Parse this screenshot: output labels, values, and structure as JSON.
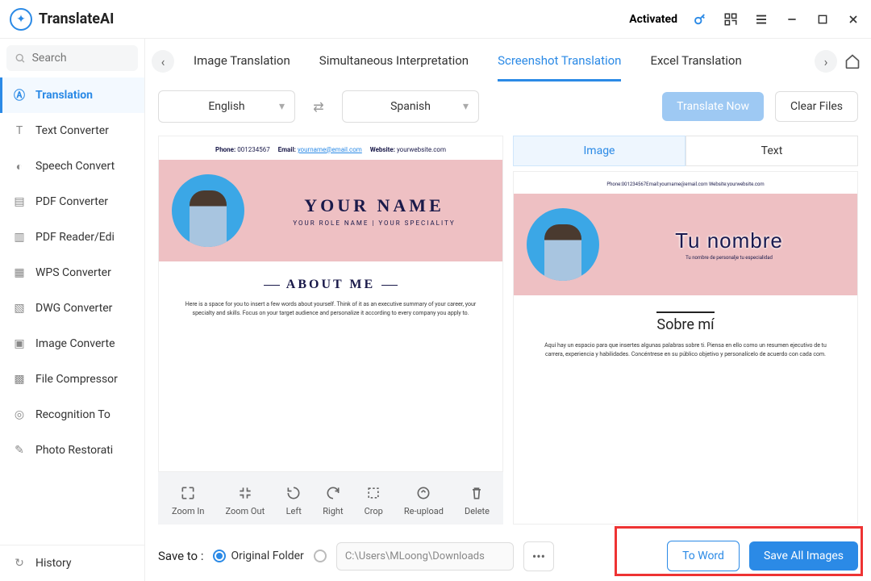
{
  "app": {
    "name": "TranslateAI",
    "activated": "Activated"
  },
  "search": {
    "placeholder": "Search"
  },
  "sidebar": {
    "items": [
      {
        "label": "Translation"
      },
      {
        "label": "Text Converter"
      },
      {
        "label": "Speech Convert"
      },
      {
        "label": "PDF Converter"
      },
      {
        "label": "PDF Reader/Edi"
      },
      {
        "label": "WPS Converter"
      },
      {
        "label": "DWG Converter"
      },
      {
        "label": "Image Converte"
      },
      {
        "label": "File Compressor"
      },
      {
        "label": "Recognition To"
      },
      {
        "label": "Photo Restorati"
      }
    ],
    "history": "History"
  },
  "tabs": {
    "items": [
      {
        "label": "Image Translation"
      },
      {
        "label": "Simultaneous Interpretation"
      },
      {
        "label": "Screenshot Translation"
      },
      {
        "label": "Excel Translation"
      }
    ]
  },
  "lang": {
    "from": "English",
    "to": "Spanish",
    "translate": "Translate Now",
    "clear": "Clear Files"
  },
  "subtabs": {
    "image": "Image",
    "text": "Text"
  },
  "doc": {
    "phone_label": "Phone:",
    "phone": "001234567",
    "email_label": "Email:",
    "email": "yourname@email.com",
    "web_label": "Website:",
    "web": "yourwebsite.com",
    "name": "YOUR NAME",
    "role": "YOUR ROLE NAME | YOUR SPECIALITY",
    "about": "ABOUT ME",
    "about_text": "Here is a space for you to insert a few words about yourself. Think of it as an executive summary of your career, your specialty and skills. Focus on your target audience and personalize it according to every company you apply to."
  },
  "doc_es": {
    "header": "Phone:001234567Email:yourname@email.com Website:yourwebsite.com",
    "name": "Tu nombre",
    "role": "Tu nombre de personalje tu especialidad",
    "about": "Sobre mí",
    "about_text": "Aquí hay un espacio para que insertes algunas palabras sobre ti. Piensa en ello como un resumen ejecutivo de tu carrera, experiencia y habilidades. Concéntrese en su público objetivo y personalícelo de acuerdo con cada com."
  },
  "tools": {
    "zoomin": "Zoom In",
    "zoomout": "Zoom Out",
    "left": "Left",
    "right": "Right",
    "crop": "Crop",
    "reupload": "Re-upload",
    "delete": "Delete"
  },
  "save": {
    "label": "Save to :",
    "orig": "Original Folder",
    "path": "C:\\Users\\MLoong\\Downloads",
    "toword": "To Word",
    "saveall": "Save All Images"
  }
}
